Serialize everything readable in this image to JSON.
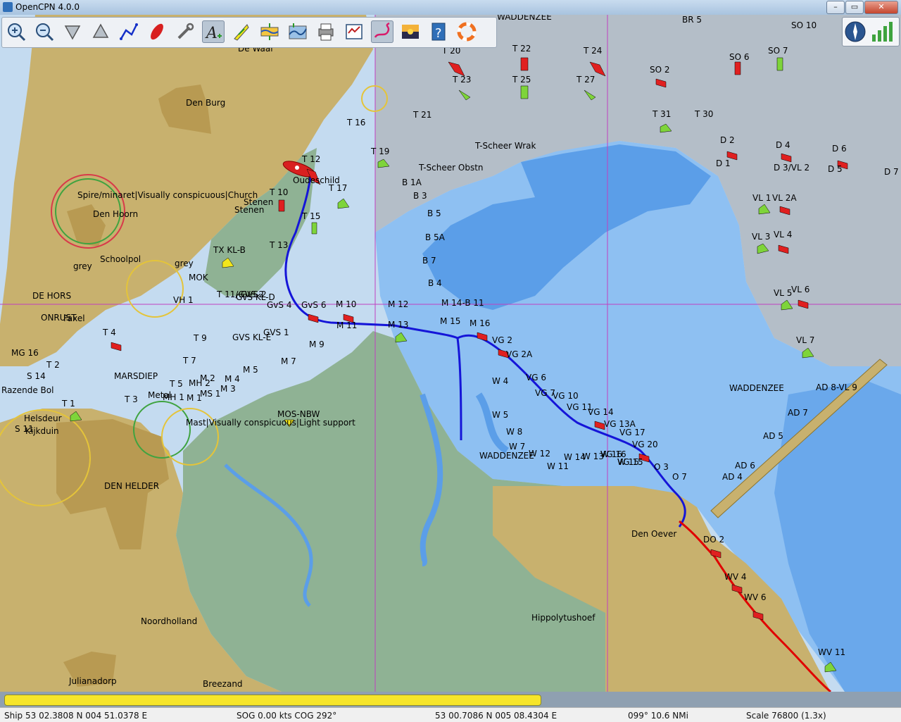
{
  "window": {
    "title": "OpenCPN 4.0.0",
    "buttons": [
      "–",
      "▭",
      "✕"
    ]
  },
  "toolbar": {
    "buttons": [
      {
        "label": "Zoom In",
        "icon": "zoom-in-icon"
      },
      {
        "label": "Zoom Out",
        "icon": "zoom-out-icon"
      },
      {
        "label": "Scale In",
        "icon": "scale-in-icon"
      },
      {
        "label": "Scale Out",
        "icon": "scale-out-icon"
      },
      {
        "label": "Create Route",
        "icon": "route-icon"
      },
      {
        "label": "Auto Follow",
        "icon": "ship-icon"
      },
      {
        "label": "Options",
        "icon": "wrench-icon"
      },
      {
        "label": "Text",
        "icon": "text-icon"
      },
      {
        "label": "Current",
        "icon": "current-icon"
      },
      {
        "label": "Tide",
        "icon": "tide-icon"
      },
      {
        "label": "Tide Graph",
        "icon": "tide-graph-icon"
      },
      {
        "label": "Print",
        "icon": "print-icon"
      },
      {
        "label": "Route Manager",
        "icon": "route-manager-icon"
      },
      {
        "label": "Track",
        "icon": "track-icon"
      },
      {
        "label": "Color Scheme",
        "icon": "color-scheme-icon"
      },
      {
        "label": "Help",
        "icon": "help-icon"
      },
      {
        "label": "MOB",
        "icon": "lifebuoy-icon"
      }
    ],
    "active_index": 7,
    "active_index_2": 13
  },
  "chart": {
    "colors": {
      "land": "#c8b16e",
      "town": "#b89a52",
      "deep_water": "#c4dbf0",
      "mid_water": "#8ec0f2",
      "shallow": "#5b9ee8",
      "intertidal": "#8fb294",
      "gray_zone": "#b4bec8",
      "route": "#1515d8",
      "track": "#e00000",
      "grid": "#c040c0",
      "buoy_red": "#e02020",
      "buoy_green": "#7ed43a",
      "buoy_yellow": "#f2e61b"
    },
    "place_labels": [
      "Den Burg",
      "De Waal",
      "Oudeschild",
      "Spire/minaret|Visually conspicuous|Church",
      "Den Hoorn",
      "DE HORS",
      "ONRUST",
      "Faxel",
      "MARSDIEP",
      "Helsdeur",
      "Kijkduin",
      "DEN HELDER",
      "Noordholland",
      "Julianadorp",
      "Breezand",
      "Hippolytushoef",
      "Den Oever",
      "WADDENZEE",
      "WADDENZEE",
      "WADDENZEE",
      "T-Scheer Wrak",
      "T-Scheer Obstn",
      "MOS-NBW",
      "Mast|Visually conspicuous|Light support",
      "Razende Bol",
      "Schoolpol",
      "grey",
      "grey",
      "MOK",
      "Stenen",
      "Stenen",
      "Metal"
    ],
    "buoy_labels": [
      "T 12",
      "T 10",
      "T 16",
      "T 17",
      "T 15",
      "T 19",
      "T 13",
      "T 21",
      "T 20",
      "T 23",
      "T 22",
      "T 25",
      "T 24",
      "T 27",
      "T 31",
      "T 30",
      "T 9",
      "T 7",
      "T 5",
      "T 3",
      "T 4",
      "T 2",
      "T 1",
      "T 11/GVS 2",
      "SO 10",
      "SO 6",
      "SO 7",
      "SO 2",
      "BR 5",
      "D 2",
      "D 1",
      "D 4",
      "D 3/VL 2",
      "D 6",
      "D 5",
      "D 7",
      "VL 1",
      "VL 2A",
      "VL 3",
      "VL 4",
      "VL 5",
      "VL 6",
      "VL 7",
      "AD 8-VL 9",
      "AD 7",
      "AD 5",
      "AD 6",
      "AD 4",
      "B 1A",
      "B 3",
      "B 5",
      "B 5A",
      "B 7",
      "B 4",
      "M 14-B 11",
      "M 12",
      "M 13",
      "M 10",
      "M 11",
      "M 15",
      "M 16",
      "M 9",
      "M 7",
      "M 4",
      "M 3",
      "M 2",
      "M 1",
      "M 5",
      "VG 2",
      "VG 2A",
      "VG 6",
      "VG 7",
      "VG 10",
      "VG 11",
      "VG 14",
      "VG 13A",
      "VG 17",
      "VG 20",
      "VG 15",
      "VG 16",
      "W 4",
      "W 5",
      "W 8",
      "W 7",
      "W 12",
      "W 11",
      "W 14",
      "W 13",
      "W 16",
      "W 15",
      "O 3",
      "O 7",
      "DO 2",
      "WV 4",
      "WV 6",
      "WV 11",
      "GvS 4",
      "GvS 6",
      "GVS 1",
      "GVS 2",
      "GvS KL-D",
      "GVS KL-E",
      "TX KL-B",
      "MH 2",
      "MH 1",
      "MS 1",
      "MG 16",
      "S 14",
      "S 11",
      "VH 1"
    ]
  },
  "progress": {
    "fraction": 0.6
  },
  "status": {
    "ship": "Ship 53 02.3808 N   004 51.0378 E",
    "sog": "SOG 0.00 kts  COG 292°",
    "cursor": "53 00.7086 N   005 08.4304 E",
    "bearing": "099°  10.6 NMi",
    "scale": "Scale 76800 (1.3x)"
  }
}
